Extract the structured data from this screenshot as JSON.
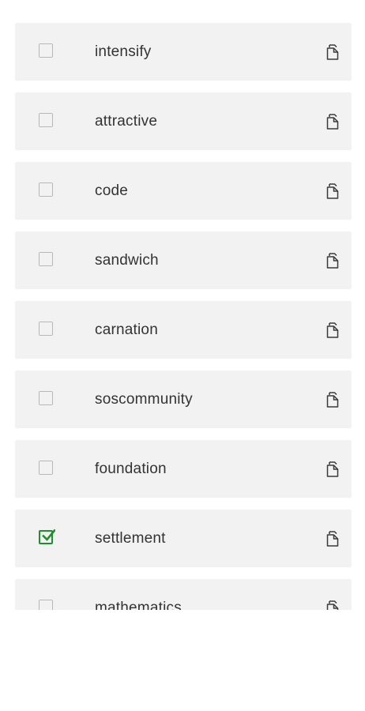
{
  "colors": {
    "row_background": "#f2f2f2",
    "checkbox_border": "#b8b8b8",
    "checked_accent": "#1e8e2f",
    "text": "#333333"
  },
  "items": [
    {
      "label": "intensify",
      "checked": false,
      "icon": "copy-icon"
    },
    {
      "label": "attractive",
      "checked": false,
      "icon": "copy-icon"
    },
    {
      "label": "code",
      "checked": false,
      "icon": "copy-icon"
    },
    {
      "label": "sandwich",
      "checked": false,
      "icon": "copy-icon"
    },
    {
      "label": "carnation",
      "checked": false,
      "icon": "copy-icon"
    },
    {
      "label": "soscommunity",
      "checked": false,
      "icon": "copy-icon"
    },
    {
      "label": "foundation",
      "checked": false,
      "icon": "copy-icon"
    },
    {
      "label": "settlement",
      "checked": true,
      "icon": "copy-icon"
    },
    {
      "label": "mathematics",
      "checked": false,
      "icon": "copy-icon"
    }
  ]
}
